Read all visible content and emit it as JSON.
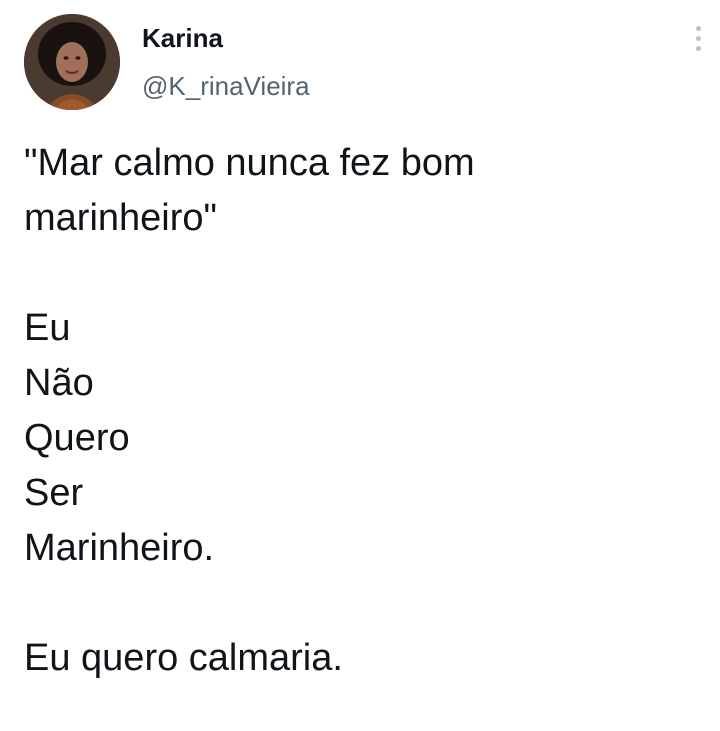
{
  "author": {
    "display_name": "Karina",
    "handle": "@K_rinaVieira",
    "avatar_icon": "profile-photo"
  },
  "menu": {
    "icon": "more-options-icon"
  },
  "tweet": {
    "quote_line1": "\"Mar calmo nunca fez bom",
    "quote_line2": "marinheiro\"",
    "line1": "Eu",
    "line2": "Não",
    "line3": "Quero",
    "line4": "Ser",
    "line5": "Marinheiro.",
    "closing": "Eu quero calmaria."
  }
}
